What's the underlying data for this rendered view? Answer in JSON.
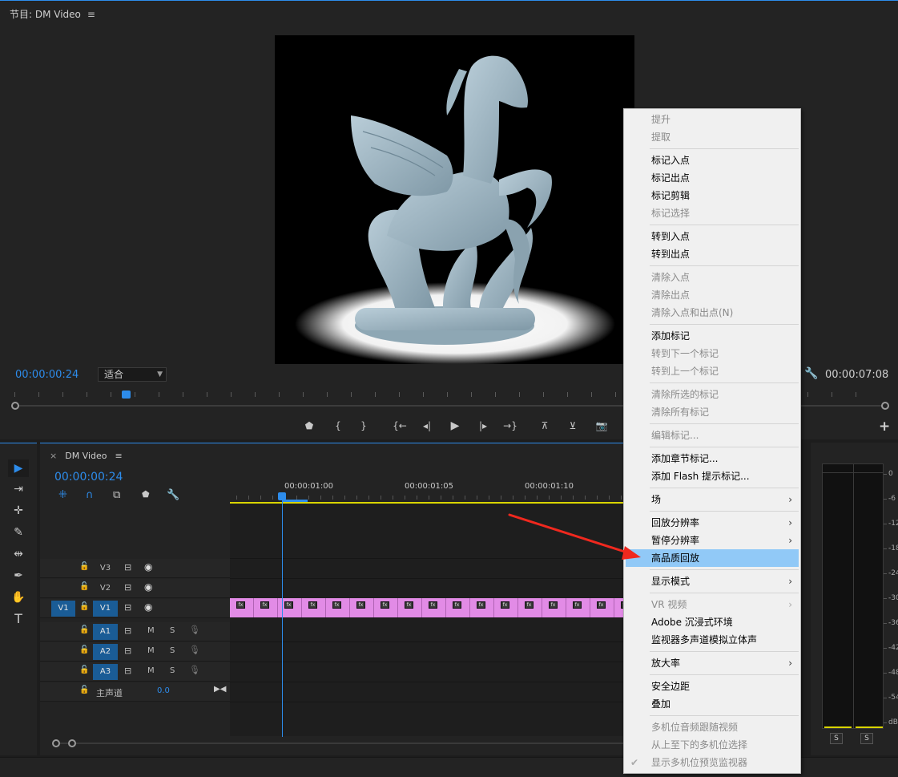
{
  "program_monitor": {
    "title": "节目: DM Video",
    "menu_glyph": "≡",
    "current_timecode": "00:00:00:24",
    "fit_option": "适合",
    "duration_timecode": "00:00:07:08",
    "add_button": "+"
  },
  "transport": {
    "marker": "⬟",
    "mark_in": "{",
    "mark_out": "}",
    "go_to_in": "{←",
    "step_back": "◂|",
    "play": "▶",
    "step_forward": "|▸",
    "go_to_out": "→}",
    "lift": "⊼",
    "extract": "⊻",
    "export_frame": "📷"
  },
  "tools": {
    "selection": "▶",
    "track_select": "⇥",
    "ripple_edit": "✛",
    "razor": "✎",
    "slip": "⇹",
    "pen": "✒",
    "hand": "✋",
    "type": "T"
  },
  "timeline": {
    "close": "×",
    "name": "DM Video",
    "menu_glyph": "≡",
    "timecode": "00:00:00:24",
    "tool_icons": {
      "nest": "⁜",
      "snap": "∩",
      "linked": "⧉",
      "marker": "⬟",
      "settings": "🔧"
    },
    "ruler": [
      {
        "label": "00:00:01:00"
      },
      {
        "label": "00:00:01:05"
      },
      {
        "label": "00:00:01:10"
      }
    ],
    "clip_fx": "fx",
    "tracks": {
      "v3": {
        "name": "V3"
      },
      "v2": {
        "name": "V2"
      },
      "v1": {
        "name": "V1",
        "source": "V1"
      },
      "a1": {
        "name": "A1",
        "m": "M",
        "s": "S"
      },
      "a2": {
        "name": "A2",
        "m": "M",
        "s": "S"
      },
      "a3": {
        "name": "A3",
        "m": "M",
        "s": "S"
      },
      "master": {
        "name": "主声道",
        "value": "0.0",
        "end": "▶◀"
      }
    },
    "lock_glyph": "🔓",
    "sync_glyph": "⊟",
    "eye_glyph": "◉",
    "mic_glyph": "🎙"
  },
  "audio_meter": {
    "db_labels": [
      "0",
      "-6",
      "-12",
      "-18",
      "-24",
      "-30",
      "-36",
      "-42",
      "-48",
      "-54",
      "dB"
    ],
    "solo_left": "S",
    "solo_right": "S"
  },
  "context_menu": {
    "items": [
      {
        "label": "提升",
        "disabled": true
      },
      {
        "label": "提取",
        "disabled": true
      },
      {
        "label": "标记入点"
      },
      {
        "label": "标记出点"
      },
      {
        "label": "标记剪辑"
      },
      {
        "label": "标记选择",
        "disabled": true
      },
      {
        "label": "转到入点"
      },
      {
        "label": "转到出点"
      },
      {
        "label": "清除入点",
        "disabled": true
      },
      {
        "label": "清除出点",
        "disabled": true
      },
      {
        "label": "清除入点和出点(N)",
        "disabled": true
      },
      {
        "label": "添加标记"
      },
      {
        "label": "转到下一个标记",
        "disabled": true
      },
      {
        "label": "转到上一个标记",
        "disabled": true
      },
      {
        "label": "清除所选的标记",
        "disabled": true
      },
      {
        "label": "清除所有标记",
        "disabled": true
      },
      {
        "label": "编辑标记...",
        "disabled": true
      },
      {
        "label": "添加章节标记..."
      },
      {
        "label": "添加 Flash 提示标记..."
      },
      {
        "label": "场",
        "submenu": true
      },
      {
        "label": "回放分辨率",
        "submenu": true
      },
      {
        "label": "暂停分辨率",
        "submenu": true
      },
      {
        "label": "高品质回放",
        "highlighted": true
      },
      {
        "label": "显示模式",
        "submenu": true
      },
      {
        "label": "VR 视频",
        "submenu": true,
        "disabled": true
      },
      {
        "label": "Adobe 沉浸式环境"
      },
      {
        "label": "监视器多声道模拟立体声"
      },
      {
        "label": "放大率",
        "submenu": true
      },
      {
        "label": "安全边距"
      },
      {
        "label": "叠加"
      },
      {
        "label": "多机位音频跟随视频",
        "disabled": true
      },
      {
        "label": "从上至下的多机位选择",
        "disabled": true
      },
      {
        "label": "显示多机位预览监视器",
        "disabled": true,
        "checked": true
      }
    ],
    "submenu_arrow": "›",
    "check_glyph": "✔"
  },
  "colors": {
    "accent": "#2d8ceb",
    "clip": "#e28be6",
    "menu_highlight": "#91c9f7",
    "annotation_arrow": "#f0281e"
  }
}
